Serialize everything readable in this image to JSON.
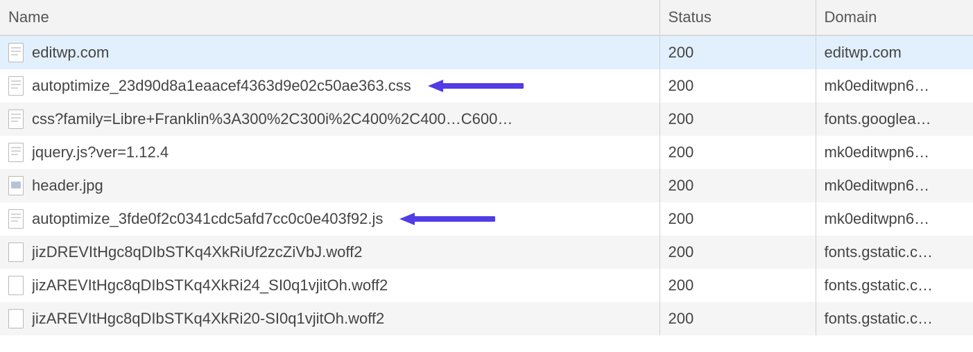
{
  "columns": {
    "name": "Name",
    "status": "Status",
    "domain": "Domain"
  },
  "arrowColor": "#513ce5",
  "rows": [
    {
      "name": "editwp.com",
      "status": "200",
      "domain": "editwp.com",
      "iconType": "text",
      "selected": true,
      "annotated": false
    },
    {
      "name": "autoptimize_23d90d8a1eaacef4363d9e02c50ae363.css",
      "status": "200",
      "domain": "mk0editwpn6…",
      "iconType": "text",
      "selected": false,
      "annotated": true
    },
    {
      "name": "css?family=Libre+Franklin%3A300%2C300i%2C400%2C400…C600…",
      "status": "200",
      "domain": "fonts.googlea…",
      "iconType": "text",
      "selected": false,
      "annotated": false
    },
    {
      "name": "jquery.js?ver=1.12.4",
      "status": "200",
      "domain": "mk0editwpn6…",
      "iconType": "text",
      "selected": false,
      "annotated": false
    },
    {
      "name": "header.jpg",
      "status": "200",
      "domain": "mk0editwpn6…",
      "iconType": "image",
      "selected": false,
      "annotated": false
    },
    {
      "name": "autoptimize_3fde0f2c0341cdc5afd7cc0c0e403f92.js",
      "status": "200",
      "domain": "mk0editwpn6…",
      "iconType": "text",
      "selected": false,
      "annotated": true
    },
    {
      "name": "jizDREVItHgc8qDIbSTKq4XkRiUf2zcZiVbJ.woff2",
      "status": "200",
      "domain": "fonts.gstatic.c…",
      "iconType": "font",
      "selected": false,
      "annotated": false
    },
    {
      "name": "jizAREVItHgc8qDIbSTKq4XkRi24_SI0q1vjitOh.woff2",
      "status": "200",
      "domain": "fonts.gstatic.c…",
      "iconType": "font",
      "selected": false,
      "annotated": false
    },
    {
      "name": "jizAREVItHgc8qDIbSTKq4XkRi20-SI0q1vjitOh.woff2",
      "status": "200",
      "domain": "fonts.gstatic.c…",
      "iconType": "font",
      "selected": false,
      "annotated": false
    }
  ]
}
